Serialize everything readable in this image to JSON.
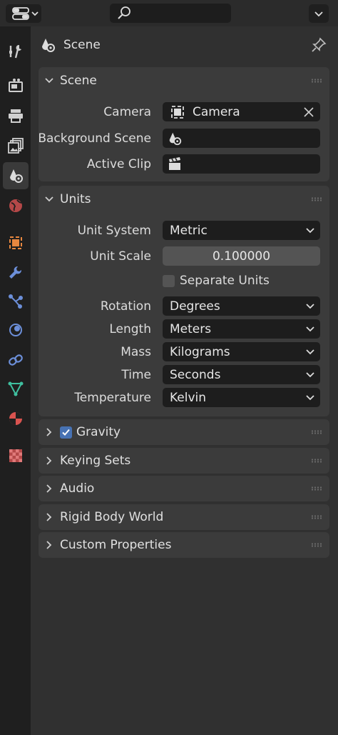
{
  "header": {
    "title": "Scene"
  },
  "scene_panel": {
    "title": "Scene",
    "camera_label": "Camera",
    "camera_value": "Camera",
    "bg_scene_label": "Background Scene",
    "bg_scene_value": "",
    "active_clip_label": "Active Clip",
    "active_clip_value": ""
  },
  "units_panel": {
    "title": "Units",
    "unit_system_label": "Unit System",
    "unit_system_value": "Metric",
    "unit_scale_label": "Unit Scale",
    "unit_scale_value": "0.100000",
    "separate_units_label": "Separate Units",
    "separate_units_checked": false,
    "rotation_label": "Rotation",
    "rotation_value": "Degrees",
    "length_label": "Length",
    "length_value": "Meters",
    "mass_label": "Mass",
    "mass_value": "Kilograms",
    "time_label": "Time",
    "time_value": "Seconds",
    "temperature_label": "Temperature",
    "temperature_value": "Kelvin"
  },
  "collapsed_panels": {
    "gravity": "Gravity",
    "gravity_checked": true,
    "keying_sets": "Keying Sets",
    "audio": "Audio",
    "rigid_body_world": "Rigid Body World",
    "custom_properties": "Custom Properties"
  },
  "colors": {
    "accent_blue": "#4772b3",
    "object_orange": "#e8873f",
    "modifier_blue": "#6c8fd9",
    "data_green": "#3fbf9f",
    "material_red": "#d9534f",
    "texture_red": "#b34848"
  },
  "tab_icons": [
    "tool-icon",
    "render-icon",
    "output-icon",
    "view-layer-icon",
    "scene-icon",
    "world-icon",
    "object-icon",
    "modifier-icon",
    "particles-icon",
    "physics-icon",
    "constraints-icon",
    "data-icon",
    "material-icon",
    "texture-icon"
  ]
}
